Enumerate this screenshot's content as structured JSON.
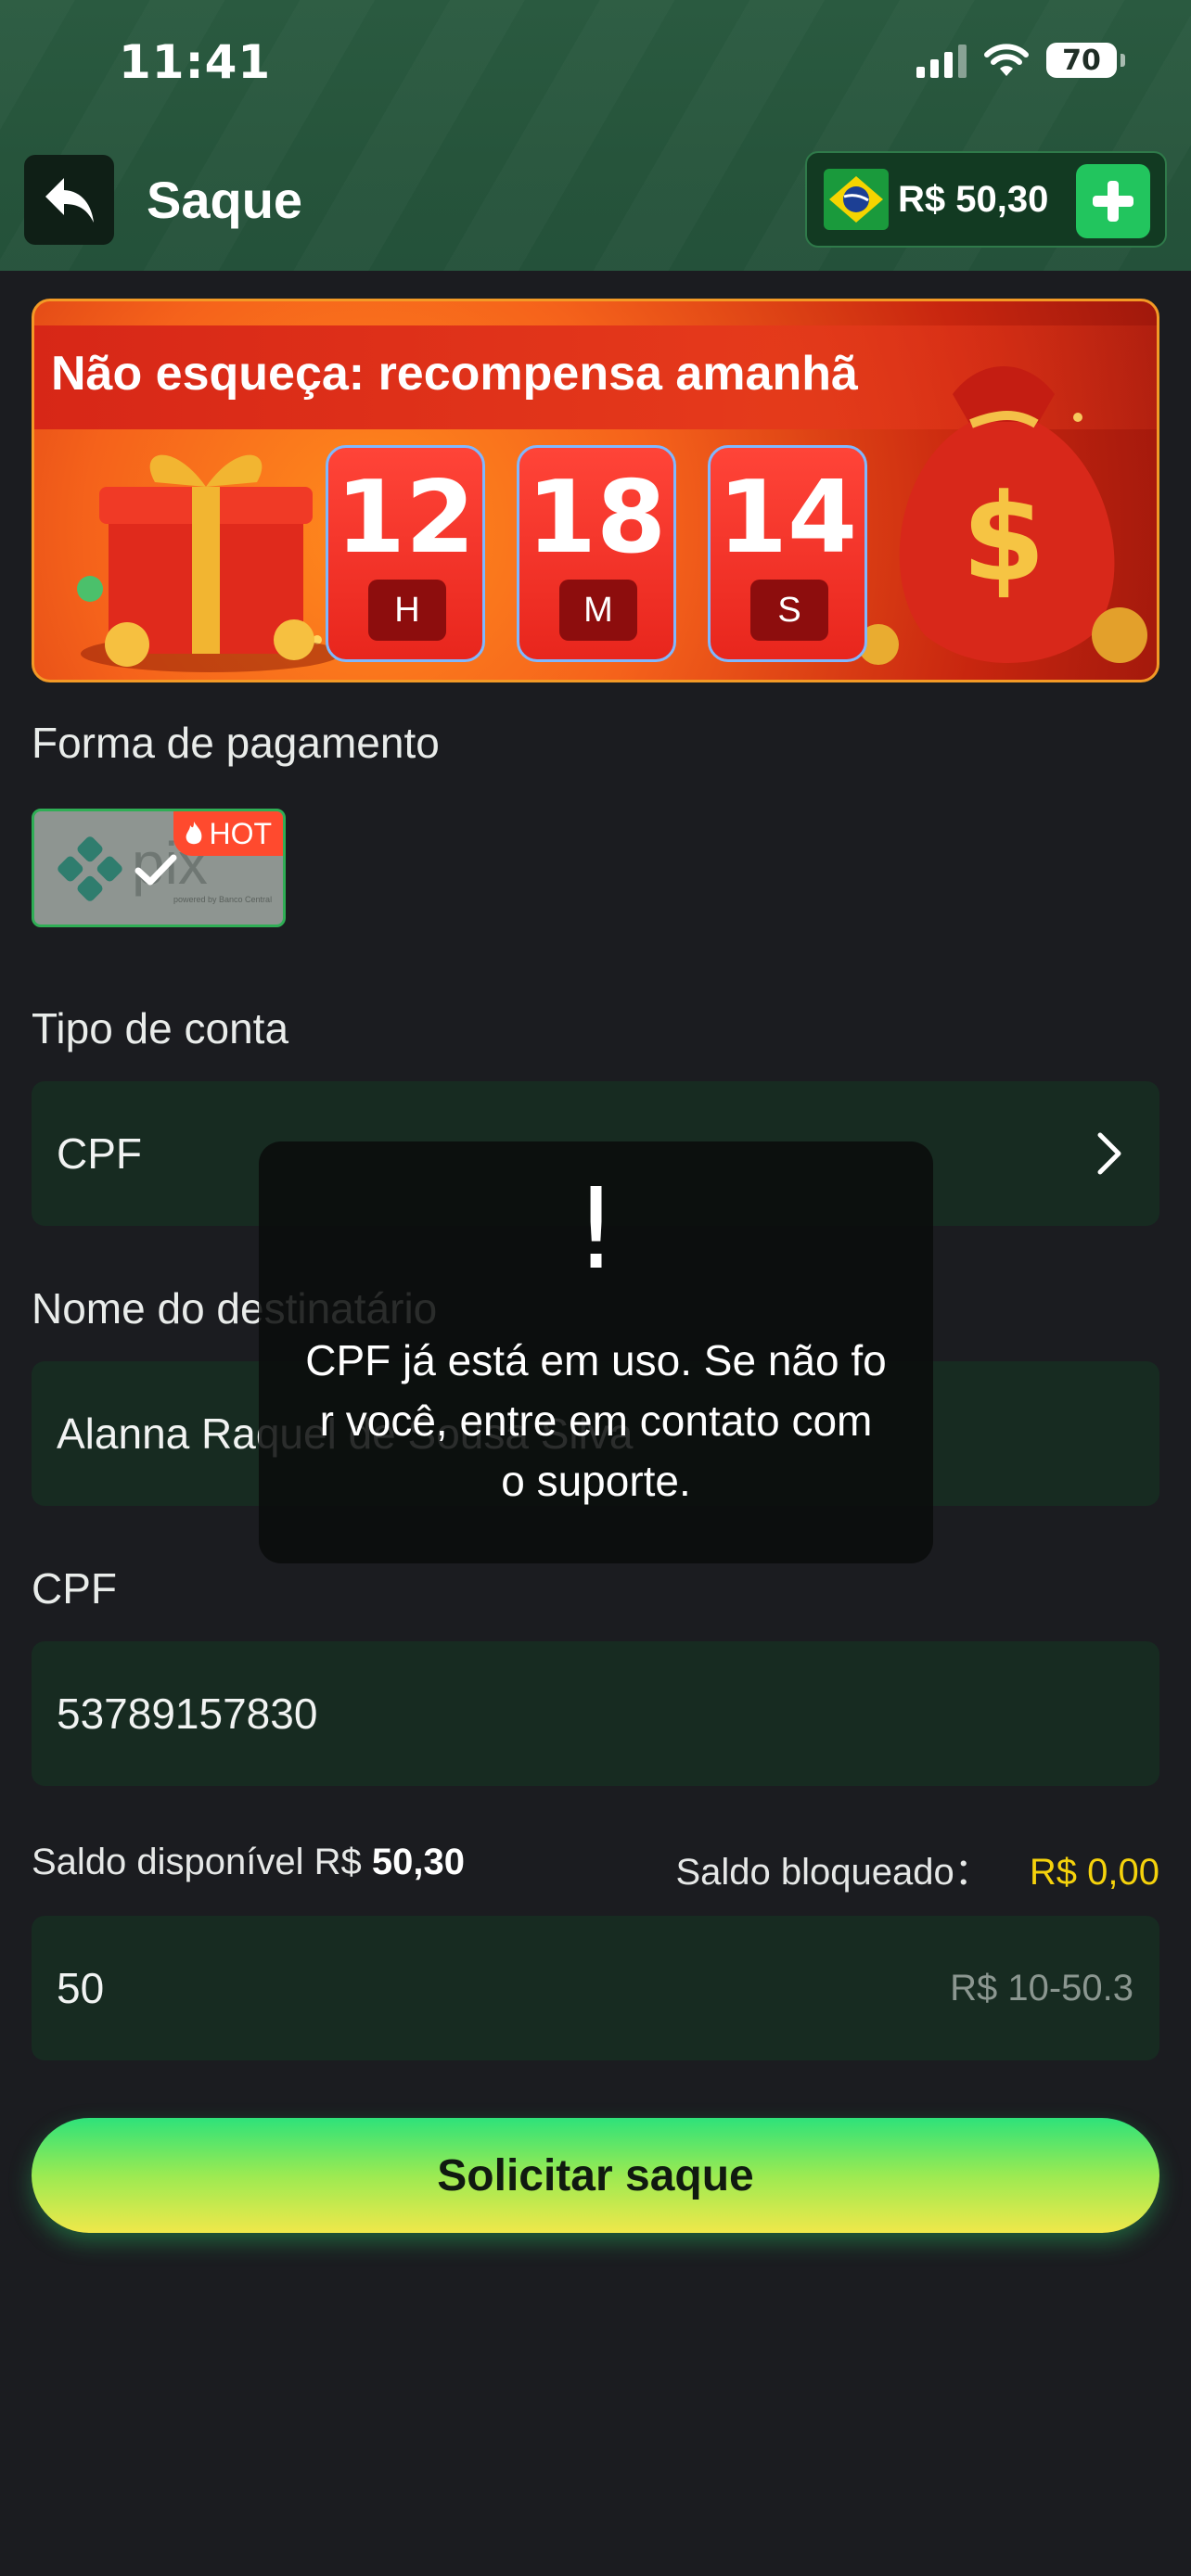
{
  "status_bar": {
    "time": "11:41",
    "battery": "70"
  },
  "header": {
    "title": "Saque",
    "balance": "R$ 50,30"
  },
  "banner": {
    "title": "Não esqueça: recompensa amanhã",
    "timer": [
      {
        "value": "12",
        "unit": "H"
      },
      {
        "value": "18",
        "unit": "M"
      },
      {
        "value": "14",
        "unit": "S"
      }
    ]
  },
  "payment": {
    "label": "Forma de pagamento",
    "method_name": "pix",
    "method_caption": "powered by Banco Central",
    "badge": "HOT"
  },
  "account_type": {
    "label": "Tipo de conta",
    "value": "CPF"
  },
  "recipient": {
    "label": "Nome do destinatário",
    "value": "Alanna Raquel de Sousa Silva"
  },
  "cpf": {
    "label": "CPF",
    "value": "53789157830"
  },
  "balance_info": {
    "available_label": "Saldo disponível R$",
    "available_value": "50,30",
    "blocked_label": "Saldo bloqueado：",
    "blocked_value": "R$ 0,00"
  },
  "amount": {
    "value": "50",
    "hint": "R$ 10-50.3"
  },
  "submit": {
    "label": "Solicitar saque"
  },
  "toast": {
    "icon": "!",
    "message": "CPF já está em uso. Se não for você, entre em contato com o suporte."
  },
  "colors": {
    "header_bg": "#26543b",
    "page_bg": "#1b1c20",
    "field_bg": "#172b21",
    "accent_green": "#22c55e",
    "blocked_yellow": "#f5d20c",
    "hot_badge": "#ff4a2e"
  }
}
